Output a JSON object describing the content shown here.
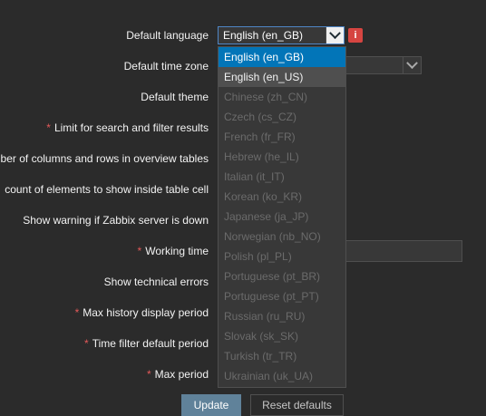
{
  "form": {
    "rows": [
      {
        "label": "Default language",
        "required": false
      },
      {
        "label": "Default time zone",
        "required": false
      },
      {
        "label": "Default theme",
        "required": false
      },
      {
        "label": "Limit for search and filter results",
        "required": true
      },
      {
        "label": "ber of columns and rows in overview tables",
        "required": false
      },
      {
        "label": "count of elements to show inside table cell",
        "required": false
      },
      {
        "label": "Show warning if Zabbix server is down",
        "required": false
      },
      {
        "label": "Working time",
        "required": true
      },
      {
        "label": "Show technical errors",
        "required": false
      },
      {
        "label": "Max history display period",
        "required": true
      },
      {
        "label": "Time filter default period",
        "required": true
      },
      {
        "label": "Max period",
        "required": true
      }
    ],
    "required_mark": "*"
  },
  "language_select": {
    "value": "English (en_GB)",
    "info_icon": "i",
    "options": [
      {
        "label": "English (en_GB)",
        "state": "selected"
      },
      {
        "label": "English (en_US)",
        "state": "hover"
      },
      {
        "label": "Chinese (zh_CN)",
        "state": "disabled"
      },
      {
        "label": "Czech (cs_CZ)",
        "state": "disabled"
      },
      {
        "label": "French (fr_FR)",
        "state": "disabled"
      },
      {
        "label": "Hebrew (he_IL)",
        "state": "disabled"
      },
      {
        "label": "Italian (it_IT)",
        "state": "disabled"
      },
      {
        "label": "Korean (ko_KR)",
        "state": "disabled"
      },
      {
        "label": "Japanese (ja_JP)",
        "state": "disabled"
      },
      {
        "label": "Norwegian (nb_NO)",
        "state": "disabled"
      },
      {
        "label": "Polish (pl_PL)",
        "state": "disabled"
      },
      {
        "label": "Portuguese (pt_BR)",
        "state": "disabled"
      },
      {
        "label": "Portuguese (pt_PT)",
        "state": "disabled"
      },
      {
        "label": "Russian (ru_RU)",
        "state": "disabled"
      },
      {
        "label": "Slovak (sk_SK)",
        "state": "disabled"
      },
      {
        "label": "Turkish (tr_TR)",
        "state": "disabled"
      },
      {
        "label": "Ukrainian (uk_UA)",
        "state": "disabled"
      }
    ]
  },
  "buttons": {
    "update": "Update",
    "reset": "Reset defaults"
  },
  "colors": {
    "background": "#2b2b2b",
    "selected_option": "#0275b8",
    "primary_button": "#60829a",
    "required_mark": "#e45959",
    "info_icon": "#d64541"
  }
}
